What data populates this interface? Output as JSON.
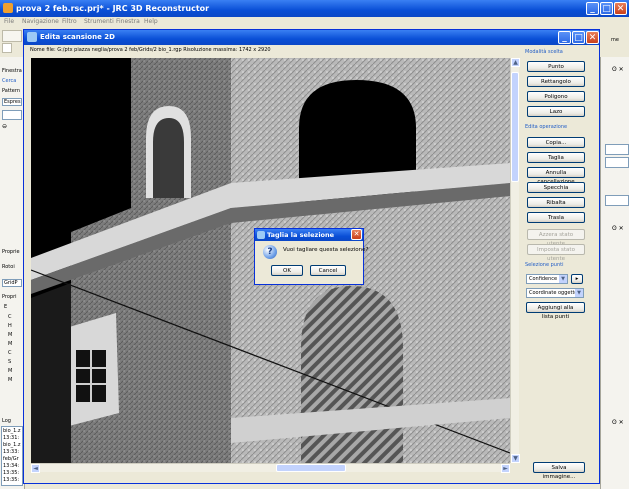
{
  "app": {
    "title": "prova 2 feb.rsc.prj* - JRC 3D Reconstructor",
    "menu": [
      "File",
      "Navigazione",
      "Filtro",
      "Strumenti",
      "Finestra",
      "Help"
    ],
    "toolbar_right_text": "me"
  },
  "left_panel": {
    "finestra_label": "Finestra",
    "cerca_label": "Cerca",
    "pattern_label": "Pattern",
    "expr_value": "Espres",
    "properties_label": "Proprie",
    "rotation_label": "Rotoi",
    "grid_label": "GridP",
    "prop_label": "Propri",
    "tree_items": [
      "E",
      "C",
      "H",
      "M",
      "M",
      "C",
      "S",
      "M",
      "M"
    ],
    "log_label": "Log",
    "log_lines": [
      "bio_1.z",
      "13:31:",
      "bio_1.z",
      "13:33:",
      "feb/Gr",
      "13:34:",
      "13:35:",
      "13:35:"
    ]
  },
  "editor": {
    "title": "Edita scansione 2D",
    "filename": "Nome file: G:/ptx piazza neglia/prova 2 feb/Grids/2 bio_1.rgp Risoluzione massima: 1742 x 2920",
    "selection_mode_header": "Modalità scelta",
    "mode_buttons": [
      "Punto",
      "Rettangolo",
      "Poligono",
      "Lazo"
    ],
    "edit_header": "Edita operazione",
    "op_buttons": [
      "Copia...",
      "Taglia",
      "Annulla cancellazione",
      "Specchia",
      "Ribalta",
      "Trasla"
    ],
    "state_buttons": [
      "Azzera stato utente",
      "Imposta stato utente"
    ],
    "points_header": "Selezione punti",
    "confidence_value": "Confidence",
    "coords_value": "Coordinate oggetto",
    "add_button": "Aggiungi alla lista punti",
    "save_button": "Salva immagine..."
  },
  "modal": {
    "title": "Taglia la selezione",
    "question": "Vuoi tagliare questa selezione?",
    "ok_label": "OK",
    "cancel_label": "Cancel"
  },
  "colors": {
    "xp_blue": "#0a4fd6",
    "face": "#ece9d8",
    "accent_text": "#215dc6"
  }
}
